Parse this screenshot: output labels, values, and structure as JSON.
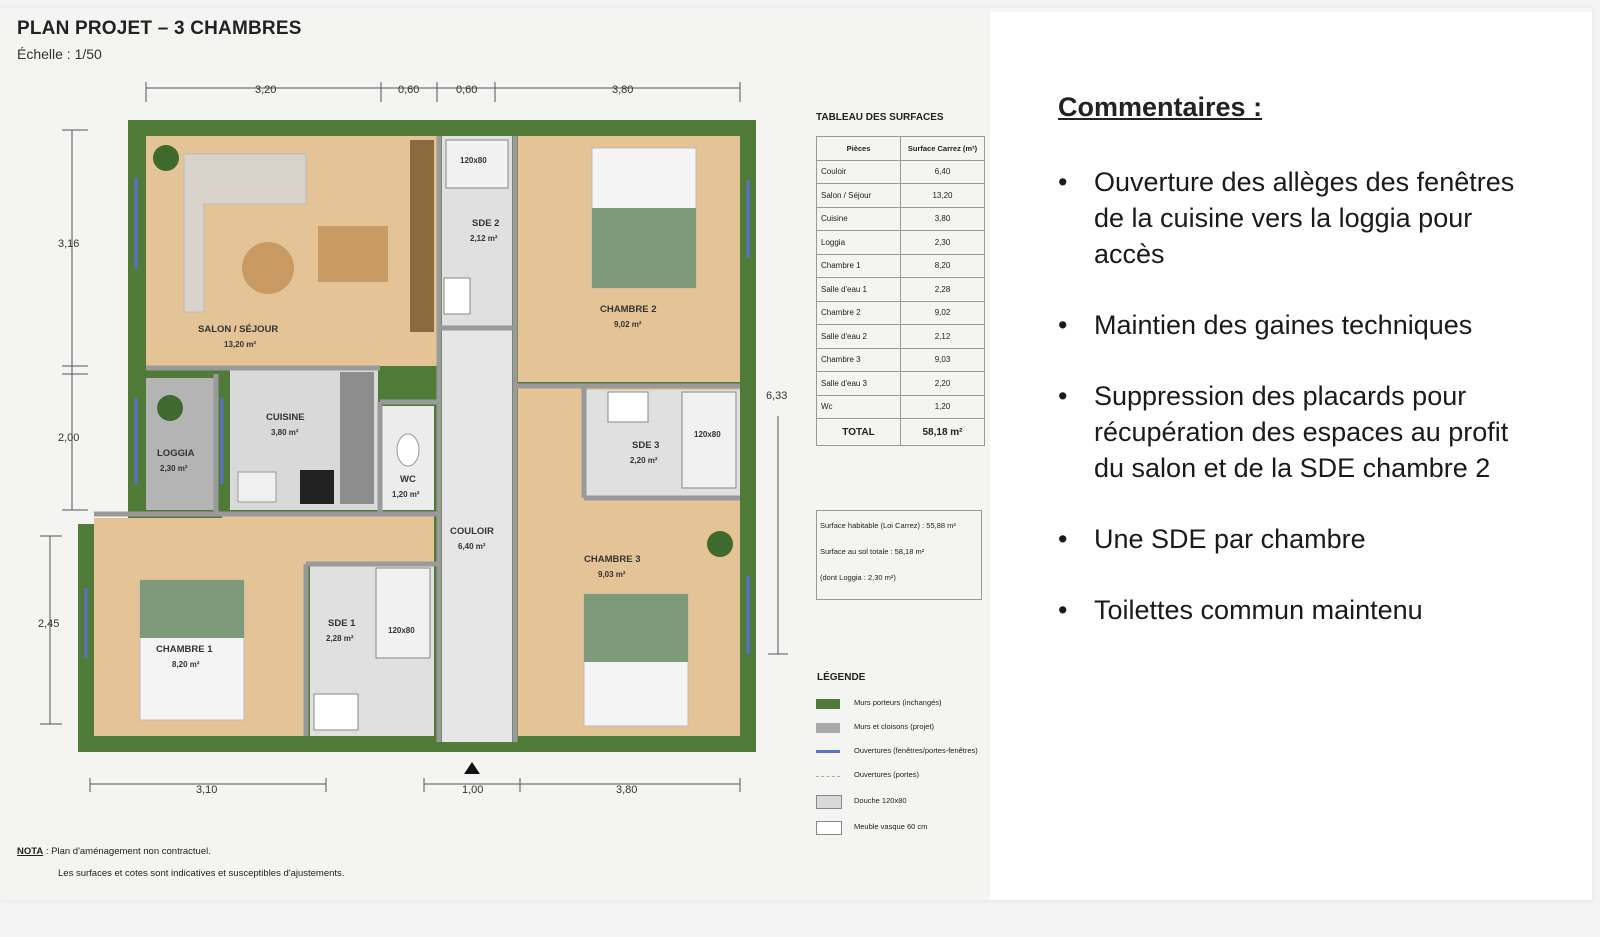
{
  "plan": {
    "title": "PLAN PROJET – 3 CHAMBRES",
    "scale": "Échelle : 1/50",
    "dims_top": [
      "3,20",
      "0,60",
      "0,60",
      "3,80"
    ],
    "dims_bottom": [
      "3,10",
      "1,00",
      "3,80"
    ],
    "dims_left": [
      "3,16",
      "2,00",
      "2,45"
    ],
    "dim_right": "6,33",
    "rooms": {
      "salon": {
        "label": "SALON / SÉJOUR",
        "area": "13,20 m²"
      },
      "cuisine": {
        "label": "CUISINE",
        "area": "3,80 m²"
      },
      "loggia": {
        "label": "LOGGIA",
        "area": "2,30 m²"
      },
      "wc": {
        "label": "WC",
        "area": "1,20 m²"
      },
      "couloir": {
        "label": "COULOIR",
        "area": "6,40 m²"
      },
      "sde2": {
        "label": "SDE 2",
        "area": "2,12 m²"
      },
      "chambre2": {
        "label": "CHAMBRE 2",
        "area": "9,02 m²"
      },
      "sde3": {
        "label": "SDE 3",
        "area": "2,20 m²"
      },
      "chambre3": {
        "label": "CHAMBRE 3",
        "area": "9,03 m²"
      },
      "sde1": {
        "label": "SDE 1",
        "area": "2,28 m²"
      },
      "chambre1": {
        "label": "CHAMBRE 1",
        "area": "8,20 m²"
      }
    },
    "shower_label": "120x80"
  },
  "surfaces": {
    "title": "TABLEAU DES SURFACES",
    "headers": [
      "Pièces",
      "Surface Carrez (m²)"
    ],
    "rows": [
      [
        "Couloir",
        "6,40"
      ],
      [
        "Salon / Séjour",
        "13,20"
      ],
      [
        "Cuisine",
        "3,80"
      ],
      [
        "Loggia",
        "2,30"
      ],
      [
        "Chambre 1",
        "8,20"
      ],
      [
        "Salle d'eau 1",
        "2,28"
      ],
      [
        "Chambre 2",
        "9,02"
      ],
      [
        "Salle d'eau 2",
        "2,12"
      ],
      [
        "Chambre 3",
        "9,03"
      ],
      [
        "Salle d'eau 3",
        "2,20"
      ],
      [
        "Wc",
        "1,20"
      ]
    ],
    "total_label": "TOTAL",
    "total_value": "58,18 m²"
  },
  "summary": {
    "line1": "Surface habitable (Loi Carrez) : 55,88 m²",
    "line2": "Surface au sol totale : 58,18 m²",
    "line3": "(dont Loggia : 2,30 m²)"
  },
  "legend": {
    "title": "LÉGENDE",
    "items": [
      {
        "label": "Murs porteurs (inchangés)",
        "color": "#4f7a37"
      },
      {
        "label": "Murs et cloisons (projet)",
        "color": "#a8a8a8"
      },
      {
        "label": "Ouvertures (fenêtres/portes-fenêtres)",
        "color": "#5b6fd1"
      },
      {
        "label": "Ouvertures (portes)",
        "color": "#cccccc"
      },
      {
        "label": "Douche 120x80",
        "color": "#d9d9d9"
      },
      {
        "label": "Meuble vasque 60 cm",
        "color": "#ffffff"
      }
    ]
  },
  "note": {
    "label": "NOTA",
    "line1": ": Plan d'aménagement non contractuel.",
    "line2": "Les surfaces et cotes sont indicatives et susceptibles d'ajustements."
  },
  "comments": {
    "title": "Commentaires :",
    "items": [
      "Ouverture des allèges des fenêtres de la cuisine vers la loggia pour accès",
      "Maintien des gaines techniques",
      "Suppression des placards pour récupération des espaces au profit du salon et de la SDE chambre 2",
      "Une SDE par chambre",
      "Toilettes commun maintenu"
    ]
  },
  "colors": {
    "wall": "#4f7a37",
    "floor": "#e4c496",
    "tile": "#dcdcdc",
    "window": "#5b6fd1",
    "bed": "#7f9a7a"
  }
}
